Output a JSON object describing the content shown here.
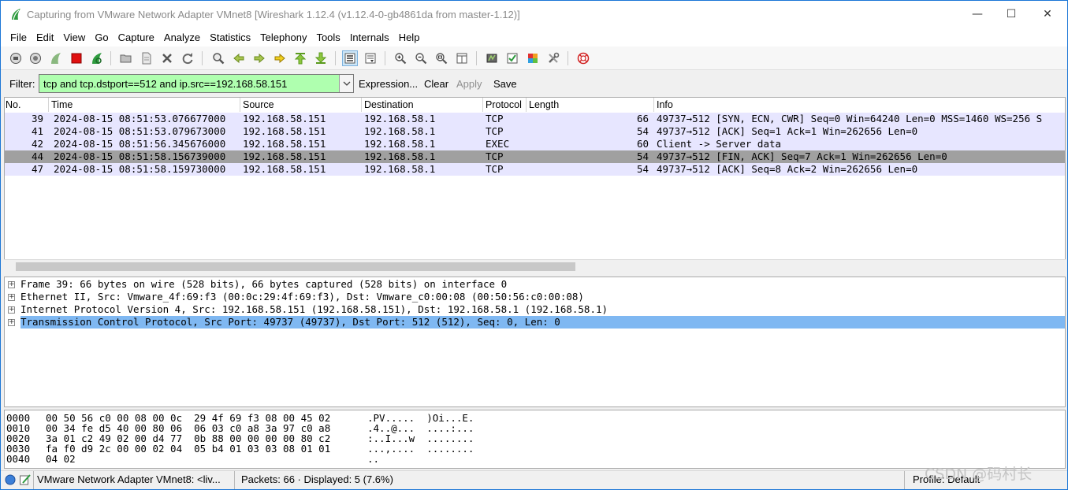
{
  "titlebar": {
    "title": "Capturing from VMware Network Adapter VMnet8    [Wireshark 1.12.4  (v1.12.4-0-gb4861da from master-1.12)]",
    "minimize": "—",
    "maximize": "☐",
    "close": "✕"
  },
  "menu": [
    "File",
    "Edit",
    "View",
    "Go",
    "Capture",
    "Analyze",
    "Statistics",
    "Telephony",
    "Tools",
    "Internals",
    "Help"
  ],
  "filter": {
    "label": "Filter:",
    "value": "tcp and tcp.dstport==512 and ip.src==192.168.58.151",
    "bg_color": "#afffaf",
    "expression": "Expression...",
    "clear": "Clear",
    "apply": "Apply",
    "save": "Save"
  },
  "packet_list": {
    "columns": [
      "No.",
      "Time",
      "Source",
      "Destination",
      "Protocol",
      "Length",
      "Info"
    ],
    "rows": [
      {
        "no": "39",
        "time": "2024-08-15 08:51:53.076677000",
        "src": "192.168.58.151",
        "dst": "192.168.58.1",
        "proto": "TCP",
        "len": "66",
        "info": "49737→512 [SYN, ECN, CWR] Seq=0 Win=64240 Len=0 MSS=1460 WS=256 S",
        "bg": "#e7e6ff",
        "fg": "#000000"
      },
      {
        "no": "41",
        "time": "2024-08-15 08:51:53.079673000",
        "src": "192.168.58.151",
        "dst": "192.168.58.1",
        "proto": "TCP",
        "len": "54",
        "info": "49737→512 [ACK] Seq=1 Ack=1 Win=262656 Len=0",
        "bg": "#e7e6ff",
        "fg": "#000000"
      },
      {
        "no": "42",
        "time": "2024-08-15 08:51:56.345676000",
        "src": "192.168.58.151",
        "dst": "192.168.58.1",
        "proto": "EXEC",
        "len": "60",
        "info": "Client -> Server data",
        "bg": "#e7e6ff",
        "fg": "#000000"
      },
      {
        "no": "44",
        "time": "2024-08-15 08:51:58.156739000",
        "src": "192.168.58.151",
        "dst": "192.168.58.1",
        "proto": "TCP",
        "len": "54",
        "info": "49737→512 [FIN, ACK] Seq=7 Ack=1 Win=262656 Len=0",
        "bg": "#a0a0a0",
        "fg": "#000000"
      },
      {
        "no": "47",
        "time": "2024-08-15 08:51:58.159730000",
        "src": "192.168.58.151",
        "dst": "192.168.58.1",
        "proto": "TCP",
        "len": "54",
        "info": "49737→512 [ACK] Seq=8 Ack=2 Win=262656 Len=0",
        "bg": "#e7e6ff",
        "fg": "#000000"
      }
    ]
  },
  "details": [
    {
      "text": "Frame 39: 66 bytes on wire (528 bits), 66 bytes captured (528 bits) on interface 0",
      "selected": false
    },
    {
      "text": "Ethernet II, Src: Vmware_4f:69:f3 (00:0c:29:4f:69:f3), Dst: Vmware_c0:00:08 (00:50:56:c0:00:08)",
      "selected": false
    },
    {
      "text": "Internet Protocol Version 4, Src: 192.168.58.151 (192.168.58.151), Dst: 192.168.58.1 (192.168.58.1)",
      "selected": false
    },
    {
      "text": "Transmission Control Protocol, Src Port: 49737 (49737), Dst Port: 512 (512), Seq: 0, Len: 0",
      "selected": true
    }
  ],
  "expander_glyph": "+",
  "selected_color": "#7fb8f2",
  "hex_dump": [
    {
      "offset": "0000",
      "hex": "00 50 56 c0 00 08 00 0c  29 4f 69 f3 08 00 45 02",
      "ascii": ".PV.....  )Oi...E."
    },
    {
      "offset": "0010",
      "hex": "00 34 fe d5 40 00 80 06  06 03 c0 a8 3a 97 c0 a8",
      "ascii": ".4..@...  ....:..."
    },
    {
      "offset": "0020",
      "hex": "3a 01 c2 49 02 00 d4 77  0b 88 00 00 00 00 80 c2",
      "ascii": ":..I...w  ........"
    },
    {
      "offset": "0030",
      "hex": "fa f0 d9 2c 00 00 02 04  05 b4 01 03 03 08 01 01",
      "ascii": "...,....  ........"
    },
    {
      "offset": "0040",
      "hex": "04 02",
      "ascii": ".."
    }
  ],
  "status": {
    "interface": "VMware Network Adapter VMnet8: <liv...",
    "packets": "Packets: 66 · Displayed: 5 (7.6%)",
    "profile": "Profile: Default"
  },
  "watermark": "CSDN @码村长",
  "icons": [
    "wireshark-logo-icon",
    "interface-list-icon",
    "capture-options-icon",
    "start-capture-icon",
    "stop-capture-icon",
    "restart-capture-icon",
    "open-file-icon",
    "save-file-icon",
    "close-file-icon",
    "reload-icon",
    "find-packet-icon",
    "go-back-icon",
    "go-forward-icon",
    "go-to-packet-icon",
    "go-first-icon",
    "go-last-icon",
    "colorize-icon",
    "auto-scroll-icon",
    "zoom-in-icon",
    "zoom-out-icon",
    "zoom-normal-icon",
    "resize-columns-icon",
    "capture-filters-icon",
    "display-filters-icon",
    "coloring-rules-icon",
    "preferences-icon",
    "help-icon"
  ]
}
